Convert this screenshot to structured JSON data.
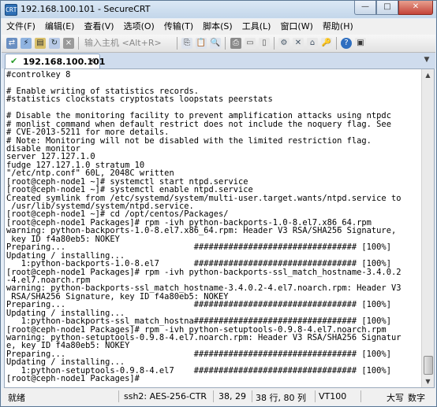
{
  "window": {
    "title": "192.168.100.101 - SecureCRT",
    "app_icon_text": "CRT",
    "minimize": "—",
    "maximize": "□",
    "close": "✕"
  },
  "menu": [
    "文件(F)",
    "编辑(E)",
    "查看(V)",
    "选项(O)",
    "传输(T)",
    "脚本(S)",
    "工具(L)",
    "窗口(W)",
    "帮助(H)"
  ],
  "toolbar": {
    "quick_connect_placeholder": "输入主机 <Alt+R>"
  },
  "tab": {
    "label": "192.168.100.101",
    "close": "✕",
    "menu": "▼"
  },
  "terminal": {
    "lines": [
      "#controlkey 8",
      "",
      "# Enable writing of statistics records.",
      "#statistics clockstats cryptostats loopstats peerstats",
      "",
      "# Disable the monitoring facility to prevent amplification attacks using ntpdc",
      "# monlist command when default restrict does not include the noquery flag. See",
      "# CVE-2013-5211 for more details.",
      "# Note: Monitoring will not be disabled with the limited restriction flag.",
      "disable monitor",
      "server 127.127.1.0",
      "fudge 127.127.1.0 stratum 10",
      "\"/etc/ntp.conf\" 60L, 2048C written",
      "[root@ceph-node1 ~]# systemctl start ntpd.service",
      "[root@ceph-node1 ~]# systemctl enable ntpd.service",
      "Created symlink from /etc/systemd/system/multi-user.target.wants/ntpd.service to",
      " /usr/lib/systemd/system/ntpd.service.",
      "[root@ceph-node1 ~]# cd /opt/centos/Packages/",
      "[root@ceph-node1 Packages]# rpm -ivh python-backports-1.0-8.el7.x86_64.rpm",
      "warning: python-backports-1.0-8.el7.x86_64.rpm: Header V3 RSA/SHA256 Signature,",
      " key ID f4a80eb5: NOKEY",
      "Preparing...                          ################################# [100%]",
      "Updating / installing...",
      "   1:python-backports-1.0-8.el7       ################################# [100%]",
      "[root@ceph-node1 Packages]# rpm -ivh python-backports-ssl_match_hostname-3.4.0.2",
      "-4.el7.noarch.rpm",
      "warning: python-backports-ssl_match_hostname-3.4.0.2-4.el7.noarch.rpm: Header V3",
      " RSA/SHA256 Signature, key ID f4a80eb5: NOKEY",
      "Preparing...                          ################################# [100%]",
      "Updating / installing...",
      "   1:python-backports-ssl_match_hostna################################# [100%]",
      "[root@ceph-node1 Packages]# rpm -ivh python-setuptools-0.9.8-4.el7.noarch.rpm",
      "warning: python-setuptools-0.9.8-4.el7.noarch.rpm: Header V3 RSA/SHA256 Signatur",
      "e, key ID f4a80eb5: NOKEY",
      "Preparing...                          ################################# [100%]",
      "Updating / installing...",
      "   1:python-setuptools-0.9.8-4.el7    ################################# [100%]",
      "[root@ceph-node1 Packages]# "
    ]
  },
  "status": {
    "state": "就绪",
    "cipher": "ssh2: AES-256-CTR",
    "cursor": "38, 29",
    "size": "38 行, 80 列",
    "emulation": "VT100",
    "caps": "大写",
    "num": "数字"
  },
  "colors": {
    "tab_check": "#2a9c2a",
    "titlebar": "#c3d6ea",
    "close_button": "#c4443a"
  }
}
